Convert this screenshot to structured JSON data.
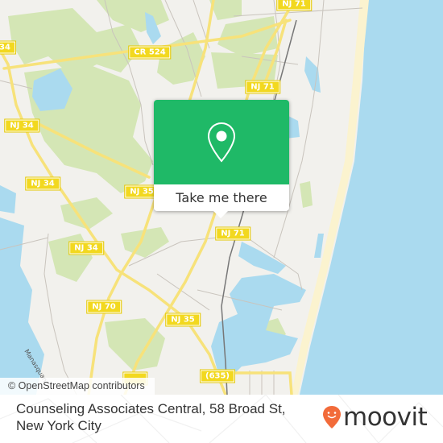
{
  "map": {
    "attribution": "© OpenStreetMap contributors",
    "road_labels": [
      {
        "id": "nj71-top",
        "text": "NJ 71"
      },
      {
        "id": "nj71-mid",
        "text": "NJ 71"
      },
      {
        "id": "nj71-low",
        "text": "NJ 71"
      },
      {
        "id": "cr524",
        "text": "CR 524"
      },
      {
        "id": "nj34-edge",
        "text": "34"
      },
      {
        "id": "nj34-a",
        "text": "NJ 34"
      },
      {
        "id": "nj34-b",
        "text": "NJ 34"
      },
      {
        "id": "nj34-c",
        "text": "NJ 34"
      },
      {
        "id": "nj35-a",
        "text": "NJ 35"
      },
      {
        "id": "nj35-b",
        "text": "NJ 35"
      },
      {
        "id": "nj70",
        "text": "NJ 70"
      },
      {
        "id": "cr635",
        "text": "(635)"
      }
    ],
    "water_label": "Manasquan",
    "colors": {
      "land": "#f2f1ed",
      "park": "#d4e6b5",
      "water": "#aadaef",
      "beach": "#fbf3cf",
      "highway": "#f7e27a",
      "shield": "#f2d81f"
    }
  },
  "popup": {
    "icon": "map-pin-icon",
    "button_label": "Take me there",
    "accent_color": "#1fb967"
  },
  "footer": {
    "address": "Counseling Associates Central, 58 Broad St, New York City",
    "brand": "moovit",
    "brand_color": "#f26b3a"
  }
}
